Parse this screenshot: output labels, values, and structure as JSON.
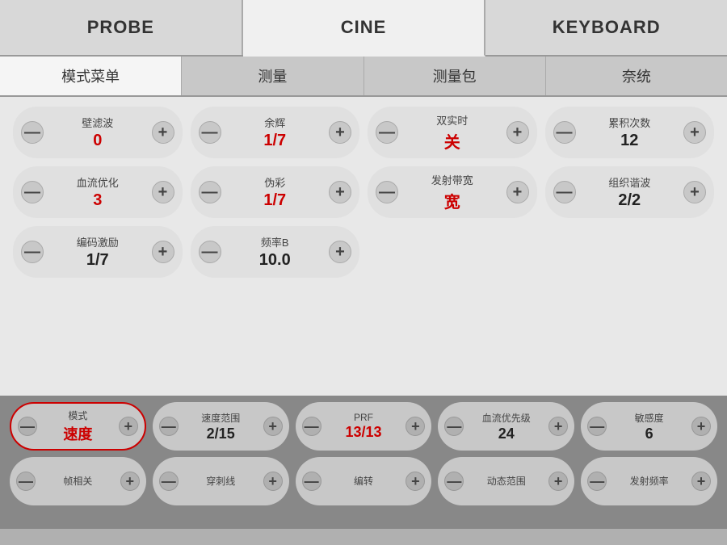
{
  "topTabs": [
    {
      "id": "probe",
      "label": "PROBE",
      "active": false
    },
    {
      "id": "cine",
      "label": "CINE",
      "active": true
    },
    {
      "id": "keyboard",
      "label": "KEYBOARD",
      "active": false
    }
  ],
  "subTabs": [
    {
      "id": "mode-menu",
      "label": "模式菜单",
      "active": true
    },
    {
      "id": "measure",
      "label": "测量",
      "active": false
    },
    {
      "id": "measure-pkg",
      "label": "测量包",
      "active": false
    },
    {
      "id": "system",
      "label": "奈统",
      "active": false
    }
  ],
  "controls": [
    {
      "label": "壁滤波",
      "value": "0",
      "valueClass": "red"
    },
    {
      "label": "余辉",
      "value": "1/7",
      "valueClass": "red"
    },
    {
      "label": "双实时",
      "value": "关",
      "valueClass": "red"
    },
    {
      "label": "累积次数",
      "value": "12",
      "valueClass": "black"
    },
    {
      "label": "血流优化",
      "value": "3",
      "valueClass": "red"
    },
    {
      "label": "伪彩",
      "value": "1/7",
      "valueClass": "red"
    },
    {
      "label": "发射带宽",
      "value": "宽",
      "valueClass": "red"
    },
    {
      "label": "组织谐波",
      "value": "2/2",
      "valueClass": "black"
    },
    {
      "label": "编码激励",
      "value": "1/7",
      "valueClass": "black"
    },
    {
      "label": "频率B",
      "value": "10.0",
      "valueClass": "black"
    },
    null,
    null
  ],
  "bottomRow1": [
    {
      "label": "模式",
      "value": "速度",
      "valueClass": "red",
      "highlighted": true
    },
    {
      "label": "速度范围",
      "value": "2/15",
      "valueClass": "black",
      "highlighted": false
    },
    {
      "label": "PRF",
      "value": "13/13",
      "valueClass": "red",
      "highlighted": false
    },
    {
      "label": "血流优先级",
      "value": "24",
      "valueClass": "black",
      "highlighted": false
    },
    {
      "label": "敏感度",
      "value": "6",
      "valueClass": "black",
      "highlighted": false
    }
  ],
  "bottomRow2": [
    {
      "label": "帧相关",
      "value": "",
      "highlighted": false
    },
    {
      "label": "穿刺线",
      "value": "",
      "highlighted": false
    },
    {
      "label": "编转",
      "value": "",
      "highlighted": false
    },
    {
      "label": "动态范围",
      "value": "",
      "highlighted": false
    },
    {
      "label": "发射频率",
      "value": "",
      "highlighted": false
    }
  ],
  "minus": "—",
  "plus": "+"
}
